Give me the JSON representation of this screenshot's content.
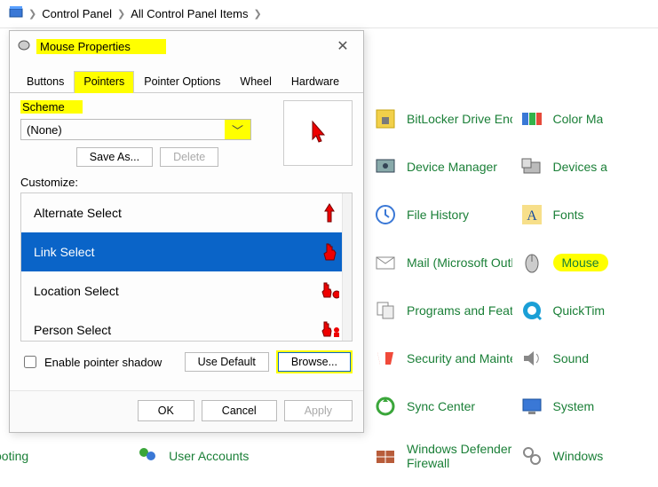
{
  "breadcrumb": {
    "item1": "Control Panel",
    "item2": "All Control Panel Items"
  },
  "dialog": {
    "title": "Mouse Properties",
    "tabs": {
      "buttons": "Buttons",
      "pointers": "Pointers",
      "pointer_options": "Pointer Options",
      "wheel": "Wheel",
      "hardware": "Hardware"
    },
    "scheme_label": "Scheme",
    "scheme_value": "(None)",
    "save_as": "Save As...",
    "delete": "Delete",
    "customize_label": "Customize:",
    "list": {
      "alt_select": "Alternate Select",
      "link_select": "Link Select",
      "location_select": "Location Select",
      "person_select": "Person Select"
    },
    "shadow_label": "Enable pointer shadow",
    "use_default": "Use Default",
    "browse": "Browse...",
    "ok": "OK",
    "cancel": "Cancel",
    "apply": "Apply"
  },
  "cp_items_bottom": {
    "ooting": "ooting",
    "user_accounts": "User Accounts"
  },
  "cp_items": {
    "bitlocker": "BitLocker Drive Encryption",
    "color_ma": "Color Ma",
    "device_manager": "Device Manager",
    "devices_a": "Devices a",
    "file_history": "File History",
    "fonts": "Fonts",
    "mail": "Mail (Microsoft Outlook)",
    "mouse": "Mouse",
    "programs": "Programs and Features",
    "quicktim": "QuickTim",
    "security": "Security and Maintenance",
    "sound": "Sound",
    "sync": "Sync Center",
    "system": "System",
    "defender": "Windows Defender Firewall",
    "windows": "Windows"
  }
}
